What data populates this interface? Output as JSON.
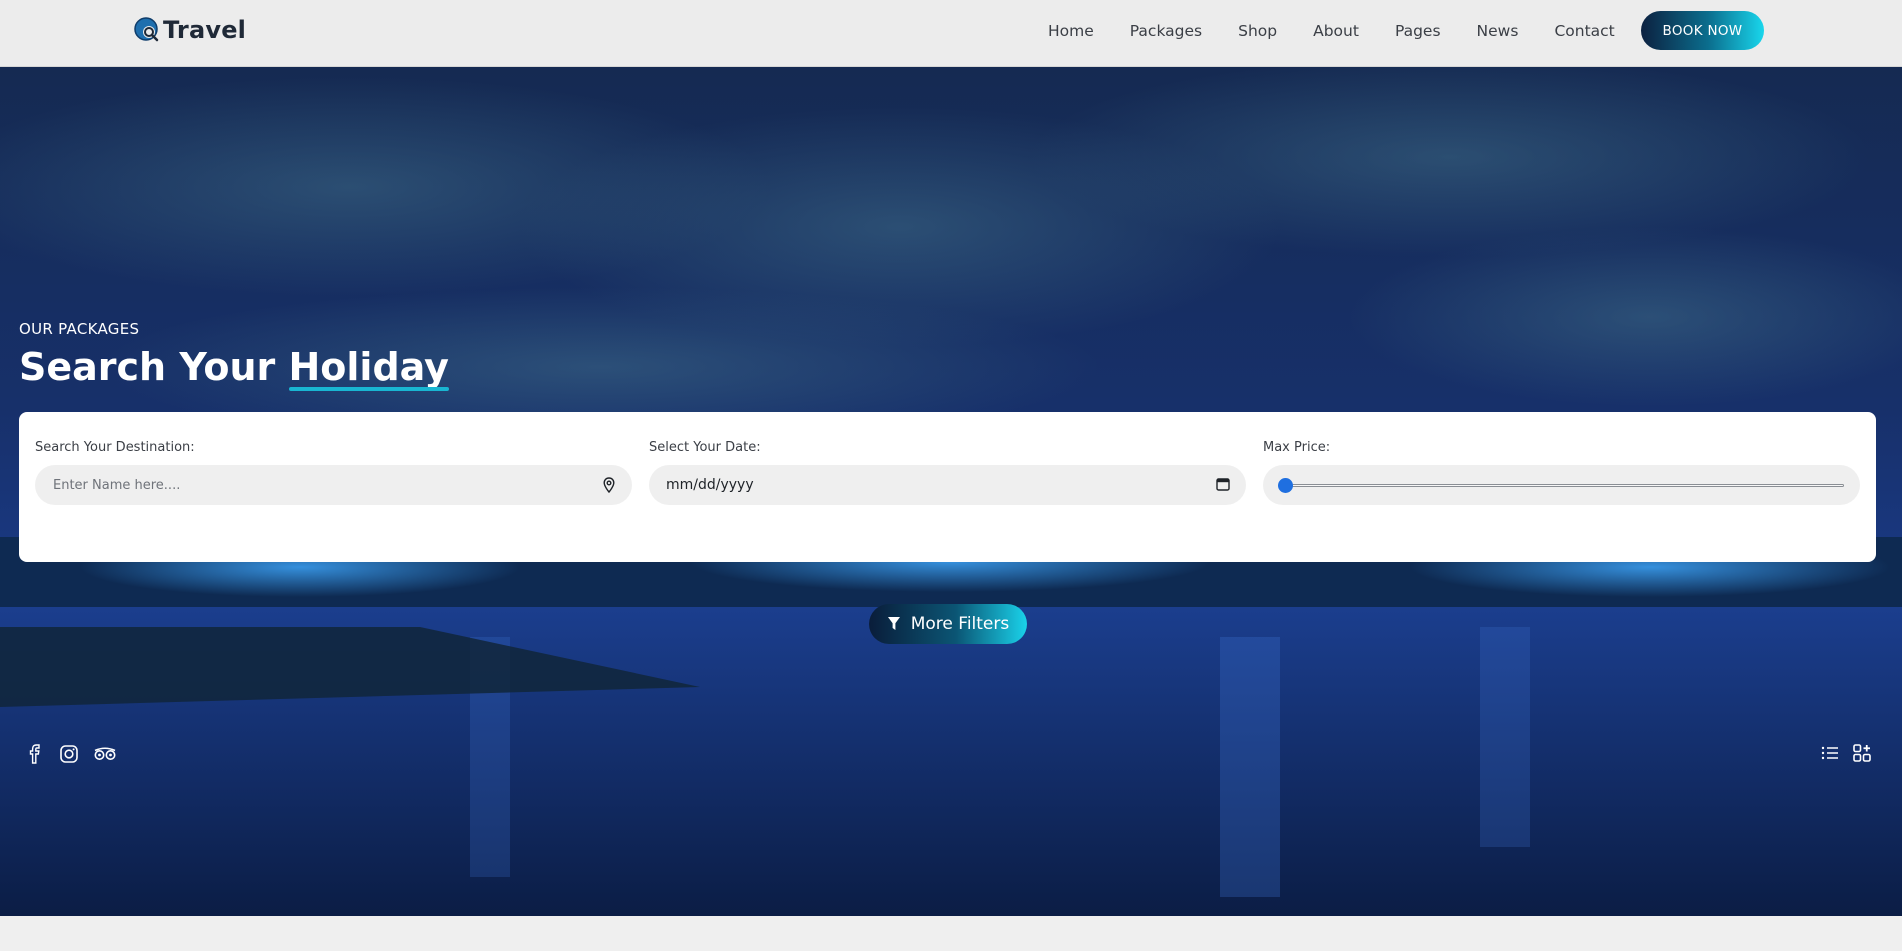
{
  "brand": {
    "name": "Travel"
  },
  "nav": {
    "items": [
      "Home",
      "Packages",
      "Shop",
      "About",
      "Pages",
      "News",
      "Contact"
    ],
    "cta": "BOOK NOW"
  },
  "hero": {
    "eyebrow": "OUR PACKAGES",
    "title_main": "Search Your",
    "title_highlight": "Holiday"
  },
  "search": {
    "destination": {
      "label": "Search Your Destination:",
      "placeholder": "Enter Name here....",
      "value": ""
    },
    "date": {
      "label": "Select Your Date:",
      "value": "mm/dd/yyyy"
    },
    "price": {
      "label": "Max Price:",
      "value_fraction": 0
    },
    "more_filters": "More Filters"
  },
  "social": [
    "facebook-icon",
    "instagram-icon",
    "tripadvisor-icon"
  ],
  "view_toggle": [
    "list-view-icon",
    "grid-view-icon"
  ],
  "colors": {
    "accent": "#19b6d2",
    "dark": "#0c2140",
    "slider": "#1f6fe0"
  }
}
